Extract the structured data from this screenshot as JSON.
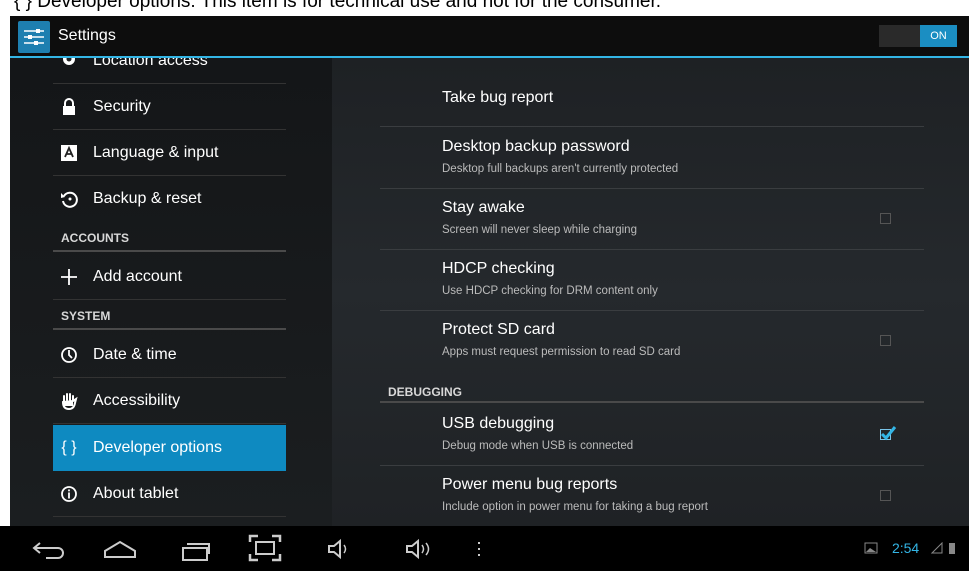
{
  "caption": "{ } Developer options: This item is for technical use and not for the consumer.",
  "actionbar": {
    "title": "Settings",
    "toggle_label": "ON",
    "settings_icon": "settings-icon"
  },
  "sidebar": {
    "items": [
      {
        "label": "Location access",
        "icon": "location-icon"
      },
      {
        "label": "Security",
        "icon": "lock-icon"
      },
      {
        "label": "Language & input",
        "icon": "language-icon"
      },
      {
        "label": "Backup & reset",
        "icon": "backup-icon"
      }
    ],
    "section_accounts": "ACCOUNTS",
    "add_account": {
      "label": "Add account",
      "icon": "plus-icon"
    },
    "section_system": "SYSTEM",
    "system_items": [
      {
        "label": "Date & time",
        "icon": "clock-icon"
      },
      {
        "label": "Accessibility",
        "icon": "hand-icon"
      },
      {
        "label": "Developer options",
        "icon": "braces-icon",
        "glyph": "{ }"
      },
      {
        "label": "About tablet",
        "icon": "info-icon"
      }
    ]
  },
  "options": {
    "items": [
      {
        "title": "Take bug report",
        "subtitle": ""
      },
      {
        "title": "Desktop backup password",
        "subtitle": "Desktop full backups aren't currently protected"
      },
      {
        "title": "Stay awake",
        "subtitle": "Screen will never sleep while charging",
        "checked": false
      },
      {
        "title": "HDCP checking",
        "subtitle": "Use HDCP checking for DRM content only"
      },
      {
        "title": "Protect SD card",
        "subtitle": "Apps must request permission to read SD card",
        "checked": false
      }
    ],
    "section_debugging": "DEBUGGING",
    "debugging_items": [
      {
        "title": "USB debugging",
        "subtitle": "Debug mode when USB is connected",
        "checked": true
      },
      {
        "title": "Power menu bug reports",
        "subtitle": "Include option in power menu for taking a bug report",
        "checked": false
      }
    ]
  },
  "navbar": {
    "icons": [
      "back-icon",
      "home-icon",
      "recents-icon",
      "screenshot-icon",
      "volume-down-icon",
      "volume-up-icon",
      "menu-icon"
    ],
    "time": "2:54"
  },
  "colors": {
    "accent": "#33b5e5",
    "selected": "#0e8ac1"
  }
}
